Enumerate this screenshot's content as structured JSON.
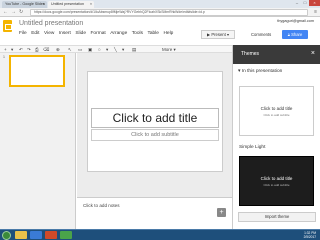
{
  "browser": {
    "tabs": [
      {
        "label": "YouTube - Google Slides",
        "active": false
      },
      {
        "label": "Untitled presentation",
        "active": true
      }
    ],
    "url": "https://docs.google.com/presentation/d/1lloAbsmup8fMjeWaj?RVYGebhQ2FIcahXSkSMmRhkWde/edit#slide=id.p"
  },
  "app": {
    "title": "Untitled presentation",
    "user_email": "thygaguri@gmail.com",
    "menu": [
      "File",
      "Edit",
      "View",
      "Insert",
      "Slide",
      "Format",
      "Arrange",
      "Tools",
      "Table",
      "Help"
    ],
    "present_label": "Present",
    "comments_label": "Comments",
    "share_label": "Share",
    "toolbar_more": "More"
  },
  "filmstrip": {
    "slide_number": "1"
  },
  "slide": {
    "title_placeholder": "Click to add title",
    "subtitle_placeholder": "Click to add subtitle"
  },
  "notes": {
    "placeholder": "Click to add notes"
  },
  "themes": {
    "header": "Themes",
    "section_label": "In this presentation",
    "cards": [
      {
        "title": "Click to add title",
        "subtitle": "Click to add subtitle"
      },
      {
        "title": "Click to add title",
        "subtitle": "Click to add subtitle"
      }
    ],
    "simple_light_label": "Simple Light",
    "import_label": "Import theme"
  },
  "taskbar": {
    "time": "1:32 PM",
    "date": "2/5/2017"
  },
  "colors": {
    "accent": "#4285f4",
    "logo": "#f4b400",
    "themes_header": "#3a3a3a",
    "taskbar": "#1e4f7b"
  }
}
